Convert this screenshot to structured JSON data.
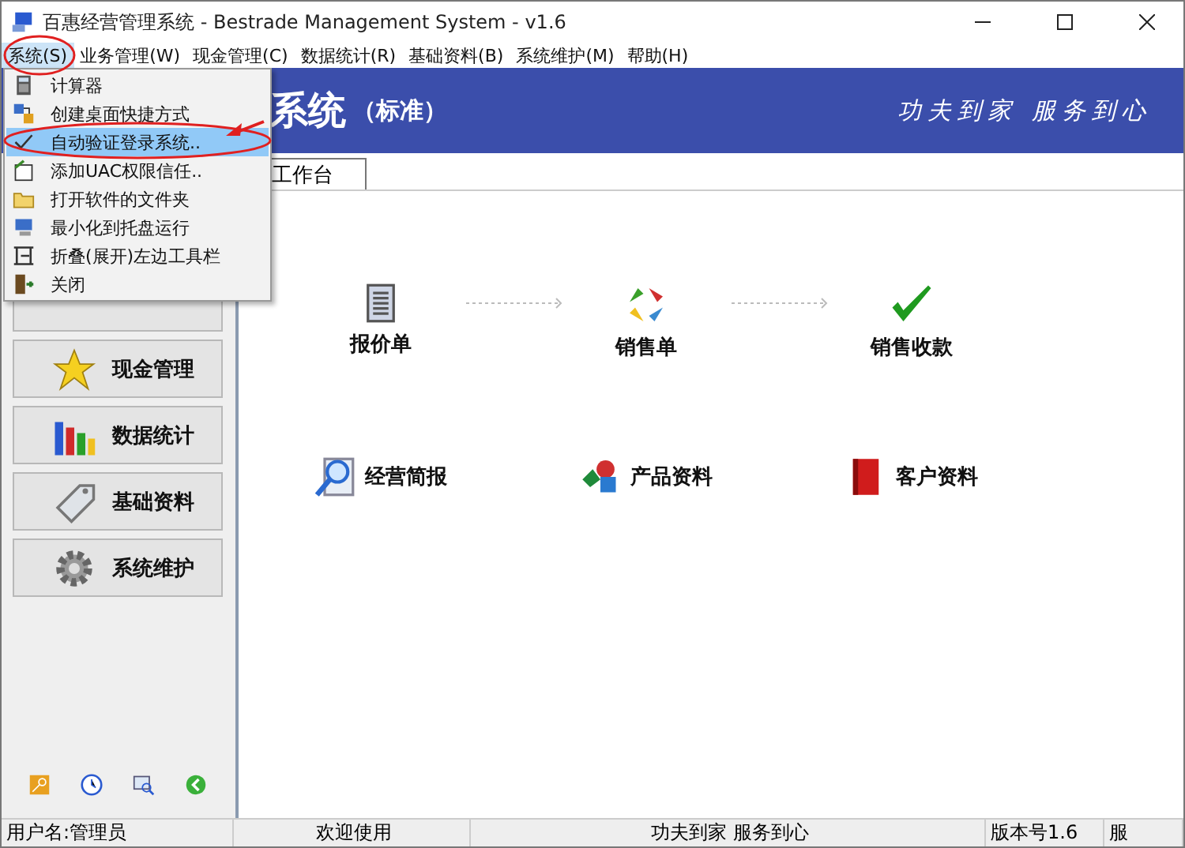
{
  "window": {
    "title": "百惠经营管理系统 - Bestrade Management System - v1.6"
  },
  "menu_bar": [
    {
      "label": "系统(S)",
      "selected": true
    },
    {
      "label": "业务管理(W)",
      "selected": false
    },
    {
      "label": "现金管理(C)",
      "selected": false
    },
    {
      "label": "数据统计(R)",
      "selected": false
    },
    {
      "label": "基础资料(B)",
      "selected": false
    },
    {
      "label": "系统维护(M)",
      "selected": false
    },
    {
      "label": "帮助(H)",
      "selected": false
    }
  ],
  "open_menu": [
    {
      "label": "计算器",
      "checked": false,
      "selected": false
    },
    {
      "label": "创建桌面快捷方式",
      "checked": false,
      "selected": false
    },
    {
      "label": "自动验证登录系统..",
      "checked": true,
      "selected": true
    },
    {
      "label": "添加UAC权限信任..",
      "checked": false,
      "selected": false
    },
    {
      "label": "打开软件的文件夹",
      "checked": false,
      "selected": false
    },
    {
      "label": "最小化到托盘运行",
      "checked": false,
      "selected": false
    },
    {
      "label": "折叠(展开)左边工具栏",
      "checked": false,
      "selected": false
    },
    {
      "label": "关闭",
      "checked": false,
      "selected": false
    }
  ],
  "banner": {
    "title": "系统",
    "subtitle": "（标准）",
    "slogan": "功夫到家 服务到心"
  },
  "tabs": [
    {
      "label": "工作台",
      "selected": true
    }
  ],
  "sidebar": {
    "items": [
      {
        "label": "现金管理"
      },
      {
        "label": "数据统计"
      },
      {
        "label": "基础资料"
      },
      {
        "label": "系统维护"
      }
    ]
  },
  "workflow": [
    {
      "label": "报价单"
    },
    {
      "label": "销售单"
    },
    {
      "label": "销售收款"
    }
  ],
  "shortcuts": [
    {
      "label": "经营简报"
    },
    {
      "label": "产品资料"
    },
    {
      "label": "客户资料"
    }
  ],
  "status_bar": [
    "用户名:管理员",
    "欢迎使用",
    "功夫到家 服务到心",
    "版本号1.6",
    "服"
  ]
}
